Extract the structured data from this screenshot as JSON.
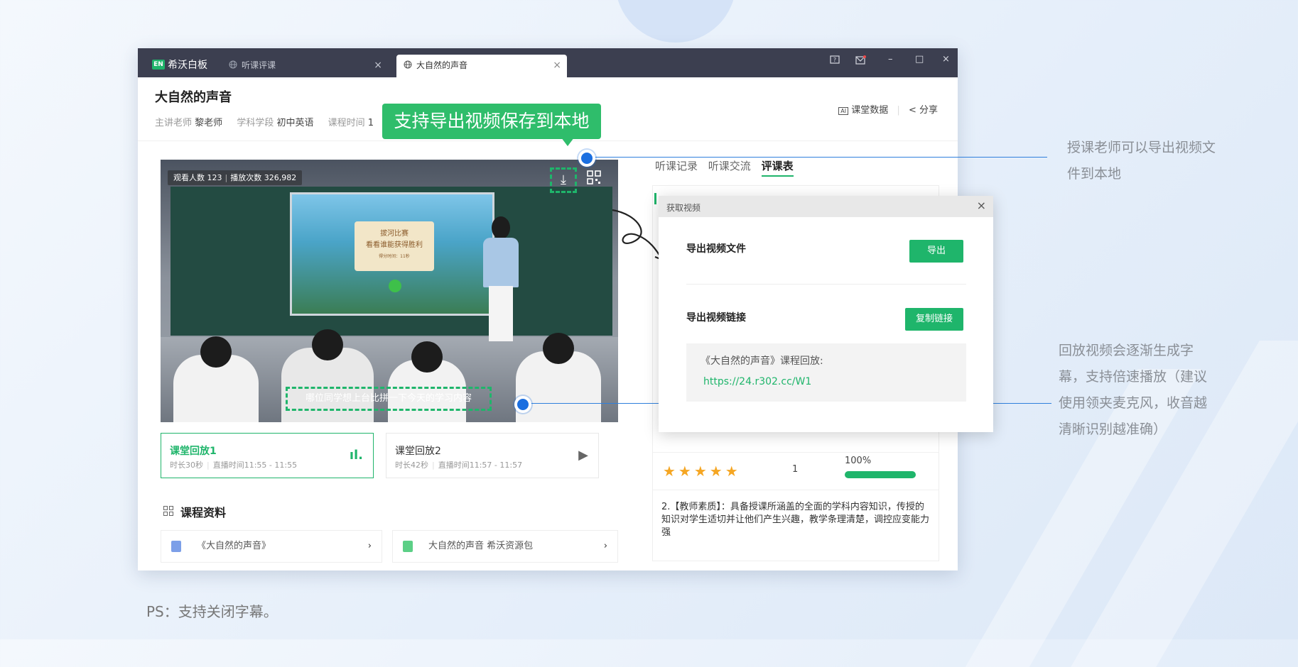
{
  "app": {
    "logo_text": "EN",
    "name": "希沃白板"
  },
  "tabs": [
    {
      "label": "听课评课"
    },
    {
      "label": "大自然的声音"
    }
  ],
  "window_controls": {
    "minimize": "–",
    "maximize": "□",
    "close": "×"
  },
  "course": {
    "title": "大自然的声音",
    "teacher_label": "主讲老师",
    "teacher": "黎老师",
    "subject_label": "学科学段",
    "subject": "初中英语",
    "time_label": "课程时间",
    "time": "1"
  },
  "header_actions": {
    "data_label": "课堂数据",
    "share_label": "分享"
  },
  "callout": "支持导出视频保存到本地",
  "video": {
    "stats_viewers": "观看人数 123",
    "stats_plays": "播放次数 326,982",
    "subtitle": "哪位同学想上台比拼一下今天的学习内容",
    "screen_card_line1": "拔河比赛",
    "screen_card_line2": "看看谁能获得胜利",
    "screen_card_line3": "得分时间：11秒"
  },
  "lessons": [
    {
      "name": "课堂回放1",
      "duration": "时长30秒",
      "live": "直播时间11:55 - 11:55",
      "active": true
    },
    {
      "name": "课堂回放2",
      "duration": "时长42秒",
      "live": "直播时间11:57 - 11:57",
      "active": false
    }
  ],
  "materials": {
    "title": "课程资料",
    "items": [
      {
        "label": "《大自然的声音》"
      },
      {
        "label": "大自然的声音 希沃资源包"
      }
    ]
  },
  "right_tabs": [
    "听课记录",
    "听课交流",
    "评课表"
  ],
  "score": {
    "stars": 5,
    "count": "1",
    "percent": "100%",
    "fill_fraction": 1.0
  },
  "criterion": "2.【教师素质】：具备授课所涵盖的全面的学科内容知识，传授的知识对学生适切并让他们产生兴趣，教学条理清楚，调控应变能力强",
  "dialog": {
    "title": "获取视频",
    "export_file_label": "导出视频文件",
    "export_button": "导出",
    "export_link_label": "导出视频链接",
    "copy_button": "复制链接",
    "link_text": "《大自然的声音》课程回放:",
    "link_url": "https://24.r302.cc/W1"
  },
  "annotations": {
    "right_top": [
      "授课老师可以导出视频文",
      "件到本地"
    ],
    "right_bottom": [
      "回放视频会逐渐生成字",
      "幕，支持倍速播放（建议",
      "使用领夹麦克风，收音越",
      "清晰识别越准确）"
    ]
  },
  "ps_note": "PS：支持关闭字幕。",
  "colors": {
    "accent": "#1fb56b",
    "titlebar": "#3c3f50",
    "annotation_line": "#2f7fdc",
    "star": "#f5a623"
  }
}
